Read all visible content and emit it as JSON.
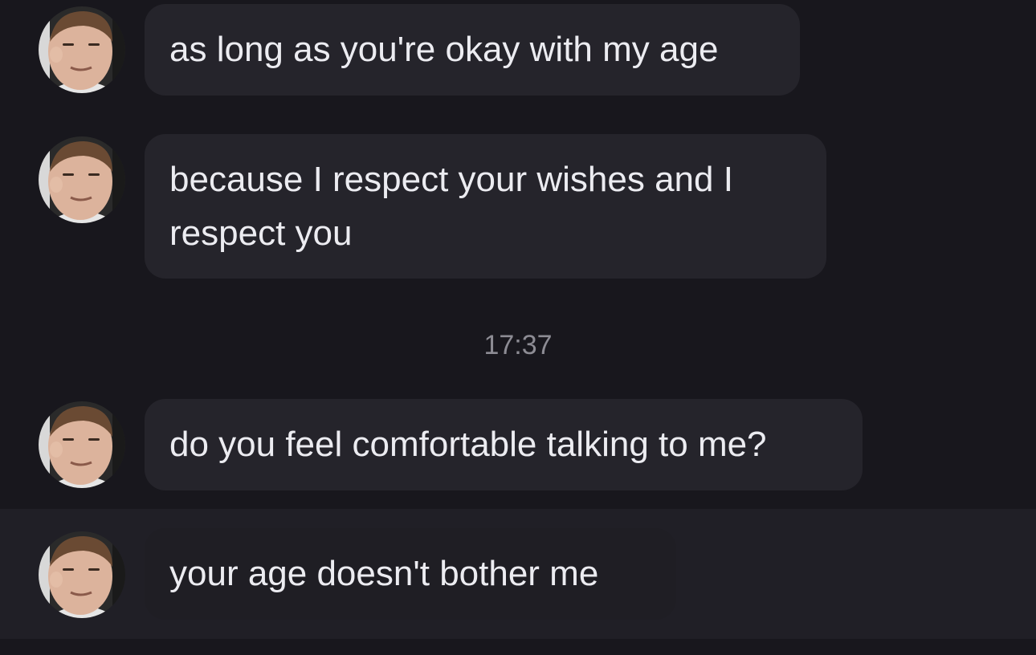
{
  "messages": [
    {
      "text": "as long as you're okay with my age"
    },
    {
      "text": "because I respect your wishes and I\nrespect you"
    },
    {
      "text": "do you feel comfortable talking to me?"
    },
    {
      "text": "your age doesn't bother me"
    }
  ],
  "timestamp": "17:37",
  "colors": {
    "background": "#18171d",
    "bubble": "#25242b",
    "text": "#ececf1",
    "timestamp": "#8d8c94"
  },
  "icons": {
    "avatar": "profile-photo"
  }
}
